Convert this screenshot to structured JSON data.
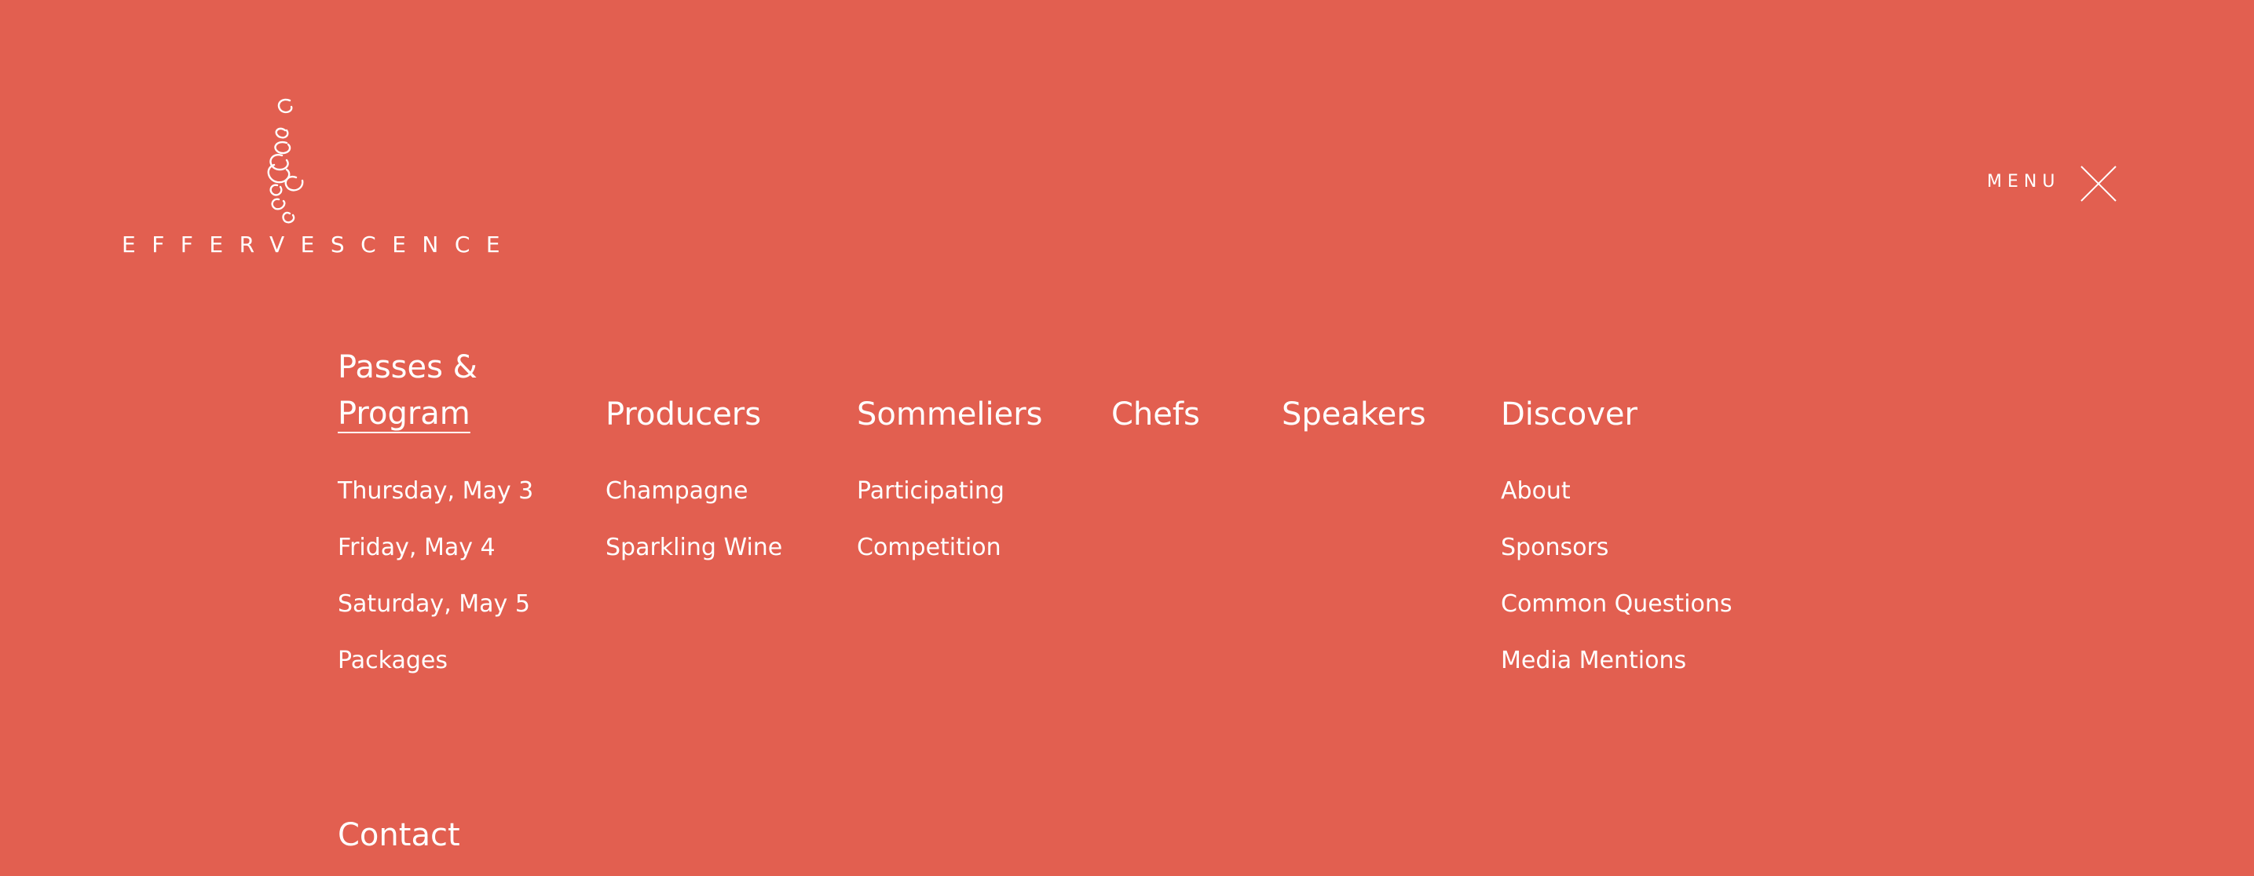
{
  "brand": {
    "name": "EFFERVESCENCE"
  },
  "menu_toggle": {
    "label": "MENU",
    "icon": "close-icon"
  },
  "nav": {
    "passes": {
      "heading_line1": "Passes &",
      "heading_line2": "Program",
      "items": [
        "Thursday, May 3",
        "Friday, May 4",
        "Saturday, May 5",
        "Packages"
      ]
    },
    "producers": {
      "heading": "Producers",
      "items": [
        "Champagne",
        "Sparkling Wine"
      ]
    },
    "sommeliers": {
      "heading": "Sommeliers",
      "items": [
        "Participating",
        "Competition"
      ]
    },
    "chefs": {
      "heading": "Chefs"
    },
    "speakers": {
      "heading": "Speakers"
    },
    "discover": {
      "heading": "Discover",
      "items": [
        "About",
        "Sponsors",
        "Common Questions",
        "Media Mentions"
      ]
    },
    "contact": {
      "heading": "Contact"
    }
  },
  "colors": {
    "background": "#e25f50",
    "text": "#ffffff"
  }
}
